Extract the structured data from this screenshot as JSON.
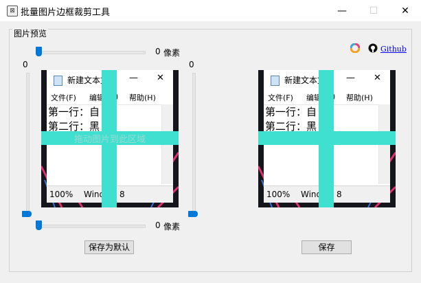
{
  "window": {
    "title": "批量图片边框裁剪工具",
    "icon": "crop-app-icon"
  },
  "group": {
    "label": "图片预览"
  },
  "top_slider": {
    "value": "0",
    "unit": "像素",
    "level": 0
  },
  "bottom_slider": {
    "value": "0",
    "unit": "像素",
    "level": 0
  },
  "left_slider": {
    "value": "0",
    "level": 0
  },
  "right_slider": {
    "value": "0",
    "level": 0
  },
  "links": {
    "github": "Github"
  },
  "preview": {
    "notepad_title": "新建文本文",
    "menu": [
      "文件(F)",
      "编辑(",
      ")",
      "帮助(H)"
    ],
    "lines": [
      "第一行：自",
      "第二行：黑"
    ],
    "status_zoom": "100%",
    "status_os": "Wind",
    "status_os2": "8",
    "hint": "拖动图片到此区域",
    "crosshair_color": "#40e0d0"
  },
  "buttons": {
    "save_default": "保存为默认",
    "save": "保存"
  }
}
